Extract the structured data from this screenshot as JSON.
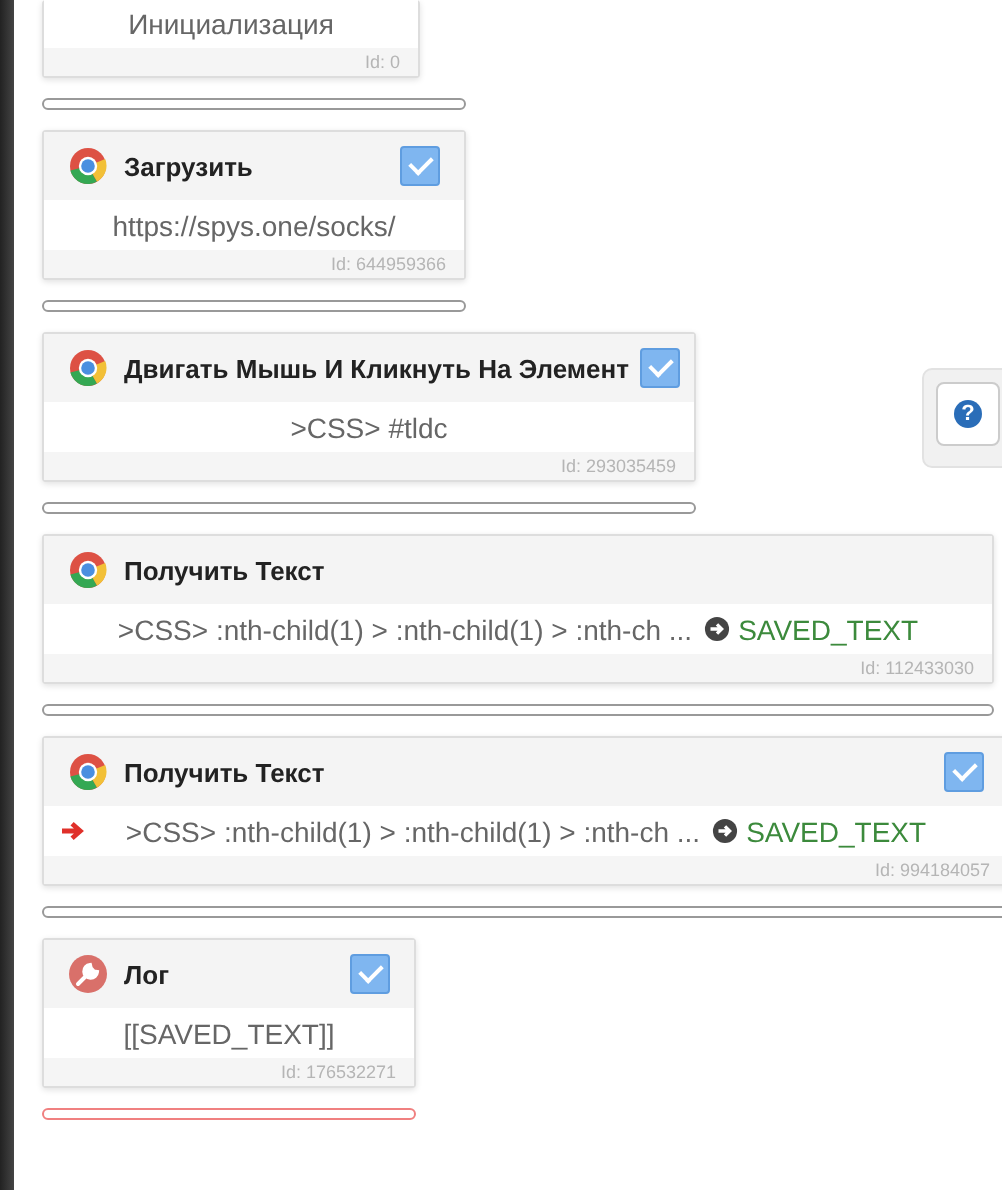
{
  "blocks": [
    {
      "body": "Инициализация",
      "id_label": "Id: 0",
      "alert": false
    },
    {
      "kind": "chrome",
      "title": "Загрузить",
      "checked": true,
      "body": "https://spys.one/socks/",
      "id_label": "Id: 644959366",
      "alert": false
    },
    {
      "kind": "chrome",
      "title": "Двигать Мышь И Кликнуть На Элемент",
      "checked": true,
      "body": ">CSS> #tldc",
      "id_label": "Id: 293035459",
      "alert": false
    },
    {
      "kind": "chrome",
      "title": "Получить Текст",
      "body": ">CSS> :nth-child(1) > :nth-child(1) > :nth-ch ...",
      "output": "SAVED_TEXT",
      "current": false,
      "id_label": "Id: 112433030",
      "alert": false
    },
    {
      "kind": "chrome",
      "title": "Получить Текст",
      "checked": true,
      "body": ">CSS> :nth-child(1) > :nth-child(1) > :nth-ch ...",
      "output": "SAVED_TEXT",
      "current": true,
      "id_label": "Id: 994184057",
      "alert": false
    },
    {
      "kind": "tool",
      "title": "Лог",
      "checked": true,
      "body": "[[SAVED_TEXT]]",
      "id_label": "Id: 176532271",
      "alert": true
    }
  ],
  "help_button": {
    "label": "?"
  }
}
